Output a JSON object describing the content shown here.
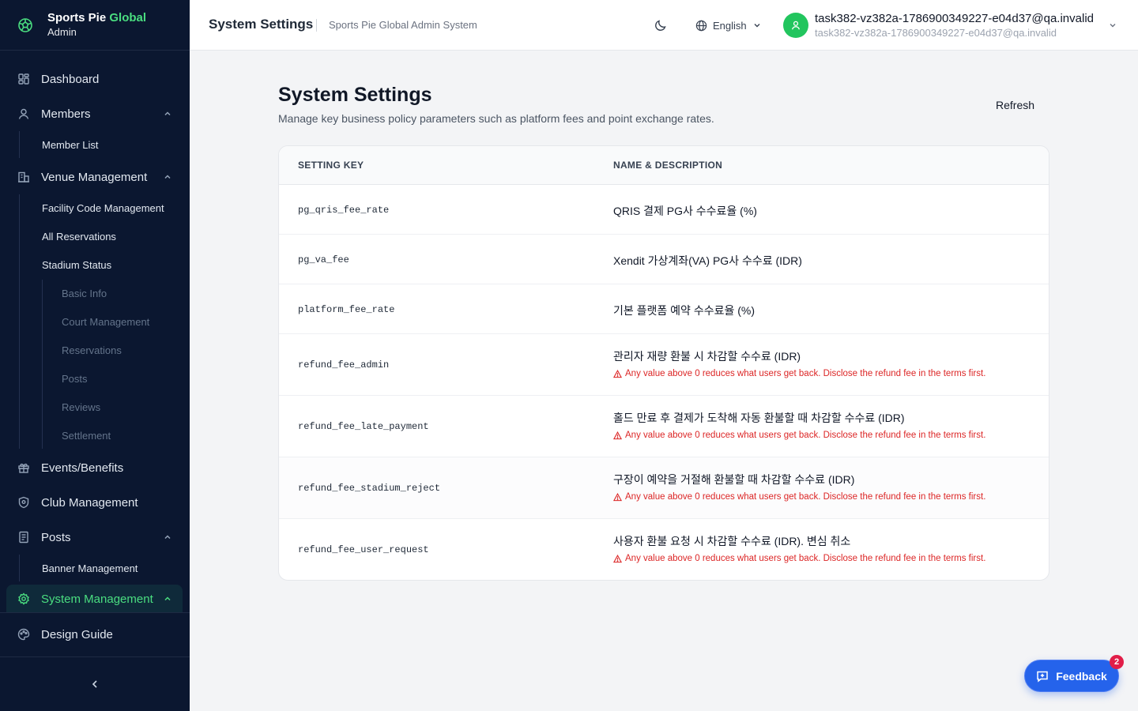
{
  "brand": {
    "name_main": "Sports Pie",
    "name_accent": "Global",
    "subtitle": "Admin"
  },
  "sidebar": {
    "items": [
      {
        "label": "Dashboard",
        "icon": "dashboard-icon"
      },
      {
        "label": "Members",
        "icon": "user-icon",
        "expanded": true,
        "children": [
          "Member List"
        ]
      },
      {
        "label": "Venue Management",
        "icon": "building-icon",
        "expanded": true,
        "children": [
          "Facility Code Management",
          "All Reservations",
          "Stadium Status"
        ],
        "stadium_children": [
          "Basic Info",
          "Court Management",
          "Reservations",
          "Posts",
          "Reviews",
          "Settlement"
        ]
      },
      {
        "label": "Events/Benefits",
        "icon": "gift-icon"
      },
      {
        "label": "Club Management",
        "icon": "shield-icon"
      },
      {
        "label": "Posts",
        "icon": "document-icon",
        "expanded": true,
        "children": [
          "Banner Management"
        ]
      },
      {
        "label": "System Management",
        "icon": "gear-icon",
        "active": true,
        "expanded": true
      },
      {
        "label": "Design Guide",
        "icon": "palette-icon"
      }
    ],
    "collapse_icon": "chevron-left-icon"
  },
  "header": {
    "title": "System Settings",
    "subtitle": "Sports Pie Global Admin System",
    "theme_icon": "moon-icon",
    "language": "English",
    "user": {
      "name": "task382-vz382a-1786900349227-e04d37@qa.invalid",
      "email": "task382-vz382a-1786900349227-e04d37@qa.invalid"
    }
  },
  "main": {
    "title": "System Settings",
    "description": "Manage key business policy parameters such as platform fees and point exchange rates.",
    "refresh_label": "Refresh",
    "columns": [
      "SETTING KEY",
      "NAME & DESCRIPTION"
    ],
    "rows": [
      {
        "key": "pg_qris_fee_rate",
        "name": "QRIS 결제 PG사 수수료율 (%)",
        "warning": ""
      },
      {
        "key": "pg_va_fee",
        "name": "Xendit 가상계좌(VA) PG사 수수료 (IDR)",
        "warning": ""
      },
      {
        "key": "platform_fee_rate",
        "name": "기본 플랫폼 예약 수수료율 (%)",
        "warning": ""
      },
      {
        "key": "refund_fee_admin",
        "name": "관리자 재량 환불 시 차감할 수수료 (IDR)",
        "warning": "Any value above 0 reduces what users get back. Disclose the refund fee in the terms first."
      },
      {
        "key": "refund_fee_late_payment",
        "name": "홀드 만료 후 결제가 도착해 자동 환불할 때 차감할 수수료 (IDR)",
        "warning": "Any value above 0 reduces what users get back. Disclose the refund fee in the terms first."
      },
      {
        "key": "refund_fee_stadium_reject",
        "name": "구장이 예약을 거절해 환불할 때 차감할 수수료 (IDR)",
        "warning": "Any value above 0 reduces what users get back. Disclose the refund fee in the terms first."
      },
      {
        "key": "refund_fee_user_request",
        "name": "사용자 환불 요청 시 차감할 수수료 (IDR). 변심 취소",
        "warning": "Any value above 0 reduces what users get back. Disclose the refund fee in the terms first."
      }
    ]
  },
  "feedback": {
    "label": "Feedback",
    "badge": "2"
  },
  "colors": {
    "sidebar_bg": "#0b1730",
    "accent_green": "#4ade80",
    "primary_blue": "#2563eb",
    "warning_red": "#dc2626"
  }
}
